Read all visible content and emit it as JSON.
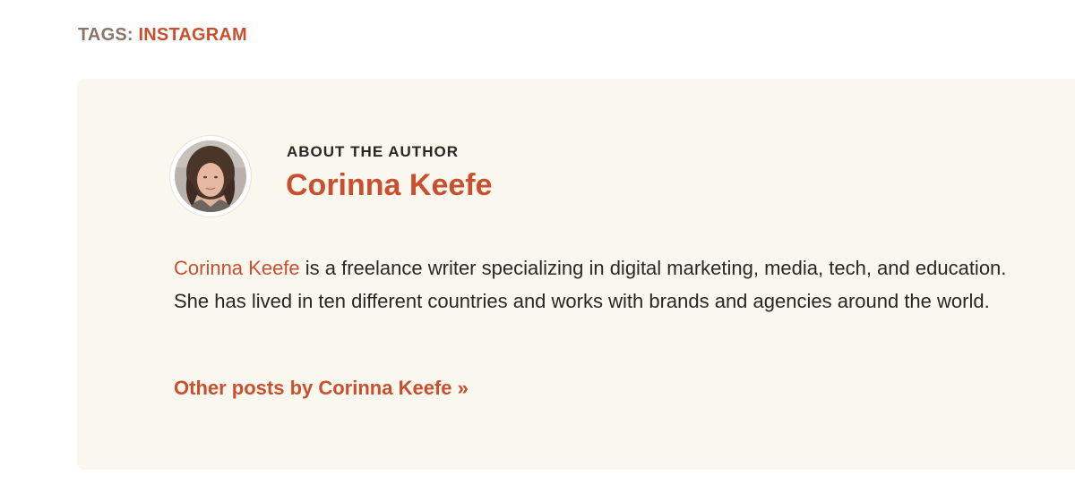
{
  "tags": {
    "label": "TAGS:",
    "items": [
      "INSTAGRAM"
    ]
  },
  "author_box": {
    "heading": "ABOUT THE AUTHOR",
    "name": "Corinna Keefe",
    "bio_name": "Corinna Keefe",
    "bio_text": " is a freelance writer specializing in digital marketing, media, tech, and education. She has lived in ten different countries and works with brands and agencies around the world.",
    "other_posts_link": "Other posts by Corinna Keefe »",
    "avatar_icon": "author-avatar"
  },
  "colors": {
    "accent": "#c9502f",
    "tag_label": "#8a7668",
    "box_background": "#faf7ef",
    "text": "#2a2623"
  }
}
